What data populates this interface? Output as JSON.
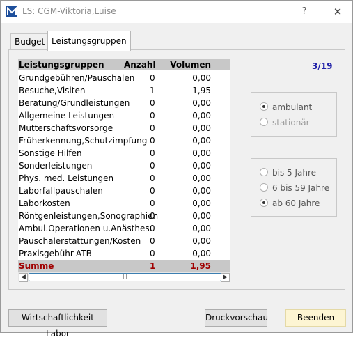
{
  "window": {
    "title": "LS: CGM-Viktoria,Luise",
    "help": "?",
    "close": "✕"
  },
  "tabs": [
    {
      "label": "Budget"
    },
    {
      "label": "Leistungsgruppen"
    }
  ],
  "grid": {
    "headers": {
      "name": "Leistungsgruppen",
      "count": "Anzahl",
      "volume": "Volumen"
    },
    "rows": [
      {
        "name": "Grundgebühren/Pauschalen",
        "count": "0",
        "volume": "0,00"
      },
      {
        "name": "Besuche,Visiten",
        "count": "1",
        "volume": "1,95"
      },
      {
        "name": "Beratung/Grundleistungen",
        "count": "0",
        "volume": "0,00"
      },
      {
        "name": "Allgemeine Leistungen",
        "count": "0",
        "volume": "0,00"
      },
      {
        "name": "Mutterschaftsvorsorge",
        "count": "0",
        "volume": "0,00"
      },
      {
        "name": "Früherkennung,Schutzimpfung",
        "count": "0",
        "volume": "0,00"
      },
      {
        "name": "Sonstige Hilfen",
        "count": "0",
        "volume": "0,00"
      },
      {
        "name": "Sonderleistungen",
        "count": "0",
        "volume": "0,00"
      },
      {
        "name": "Phys. med. Leistungen",
        "count": "0",
        "volume": "0,00"
      },
      {
        "name": "Laborfallpauschalen",
        "count": "0",
        "volume": "0,00"
      },
      {
        "name": "Laborkosten",
        "count": "0",
        "volume": "0,00"
      },
      {
        "name": "Röntgenleistungen,Sonographien",
        "count": "0",
        "volume": "0,00"
      },
      {
        "name": "Ambul.Operationen u.Anästhes.",
        "count": "0",
        "volume": "0,00"
      },
      {
        "name": "Pauschalerstattungen/Kosten",
        "count": "0",
        "volume": "0,00"
      },
      {
        "name": "Praxisgebühr-ATB",
        "count": "0",
        "volume": "0,00"
      }
    ],
    "sum": {
      "name": "Summe",
      "count": "1",
      "volume": "1,95"
    },
    "scroll_thumb": "III"
  },
  "page_indicator": "3/19",
  "care_type": {
    "options": [
      {
        "label": "ambulant",
        "selected": true
      },
      {
        "label": "stationär",
        "selected": false
      }
    ]
  },
  "age_group": {
    "options": [
      {
        "label": "bis 5 Jahre",
        "selected": false
      },
      {
        "label": "6 bis 59 Jahre",
        "selected": false
      },
      {
        "label": "ab 60 Jahre",
        "selected": true
      }
    ]
  },
  "buttons": {
    "lab_economy": "Wirtschaftlichkeit Labor",
    "print_preview": "Druckvorschau",
    "finish": "Beenden"
  }
}
